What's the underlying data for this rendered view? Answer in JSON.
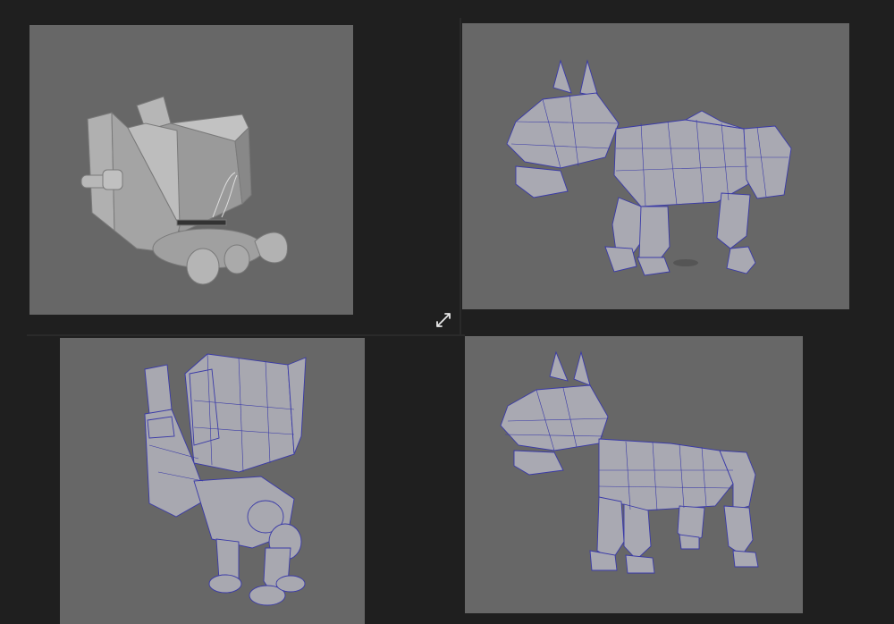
{
  "colors": {
    "background": "#1f1f1f",
    "viewport": "#676767",
    "shaded_model": "#a6a6a6",
    "wire": "#3a3aa8"
  },
  "viewports": [
    {
      "name": "viewport-top-left",
      "icon": "robot-dog-shaded-model"
    },
    {
      "name": "viewport-top-right",
      "icon": "robot-dog-wireframe-side"
    },
    {
      "name": "viewport-bottom-left",
      "icon": "robot-dog-wireframe-back"
    },
    {
      "name": "viewport-bottom-right",
      "icon": "robot-dog-wireframe-front"
    }
  ],
  "controls": {
    "expand_icon": "expand-diagonal-arrows-icon"
  }
}
